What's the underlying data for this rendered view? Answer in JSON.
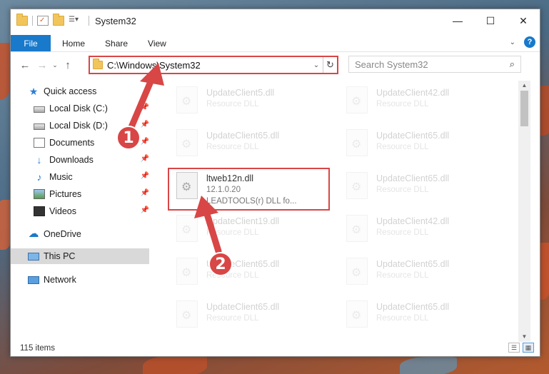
{
  "window": {
    "title": "System32",
    "controls": [
      "minimize-icon",
      "maximize-icon",
      "close-icon"
    ]
  },
  "ribbon": {
    "tabs": [
      "File",
      "Home",
      "Share",
      "View"
    ],
    "help_label": "?"
  },
  "address": {
    "path": "C:\\Windows\\System32",
    "search_placeholder": "Search System32"
  },
  "nav": {
    "items": [
      {
        "label": "Quick access",
        "icon": "star-icon"
      },
      {
        "label": "Local Disk (C:)",
        "icon": "disk-icon",
        "pinned": true
      },
      {
        "label": "Local Disk (D:)",
        "icon": "disk-icon",
        "pinned": true
      },
      {
        "label": "Documents",
        "icon": "documents-icon",
        "pinned": true
      },
      {
        "label": "Downloads",
        "icon": "download-icon",
        "pinned": true
      },
      {
        "label": "Music",
        "icon": "music-icon",
        "pinned": true
      },
      {
        "label": "Pictures",
        "icon": "pictures-icon",
        "pinned": true
      },
      {
        "label": "Videos",
        "icon": "videos-icon",
        "pinned": true
      },
      {
        "label": "OneDrive",
        "icon": "cloud-icon"
      },
      {
        "label": "This PC",
        "icon": "computer-icon",
        "selected": true
      },
      {
        "label": "Network",
        "icon": "network-icon"
      }
    ]
  },
  "files": {
    "left": [
      {
        "name": "UpdateClient5.dll",
        "desc": "Resource DLL"
      },
      {
        "name": "UpdateClient65.dll",
        "desc": "Resource DLL"
      },
      {
        "name": "ltweb12n.dll",
        "desc": "12.1.0.20",
        "extra": "LEADTOOLS(r) DLL fo...",
        "highlighted": true
      },
      {
        "name": "UpdateClient19.dll",
        "desc": "Resource DLL"
      },
      {
        "name": "UpdateClient65.dll",
        "desc": "Resource DLL"
      },
      {
        "name": "UpdateClient65.dll",
        "desc": "Resource DLL"
      }
    ],
    "right": [
      {
        "name": "UpdateClient42.dll",
        "desc": "Resource DLL"
      },
      {
        "name": "UpdateClient65.dll",
        "desc": "Resource DLL"
      },
      {
        "name": "UpdateClient65.dll",
        "desc": "Resource DLL"
      },
      {
        "name": "UpdateClient42.dll",
        "desc": "Resource DLL"
      },
      {
        "name": "UpdateClient65.dll",
        "desc": "Resource DLL"
      },
      {
        "name": "UpdateClient65.dll",
        "desc": "Resource DLL"
      }
    ]
  },
  "status": {
    "item_count": "115 items"
  },
  "annotations": {
    "step1": "1",
    "step2": "2",
    "color": "#d84646"
  }
}
